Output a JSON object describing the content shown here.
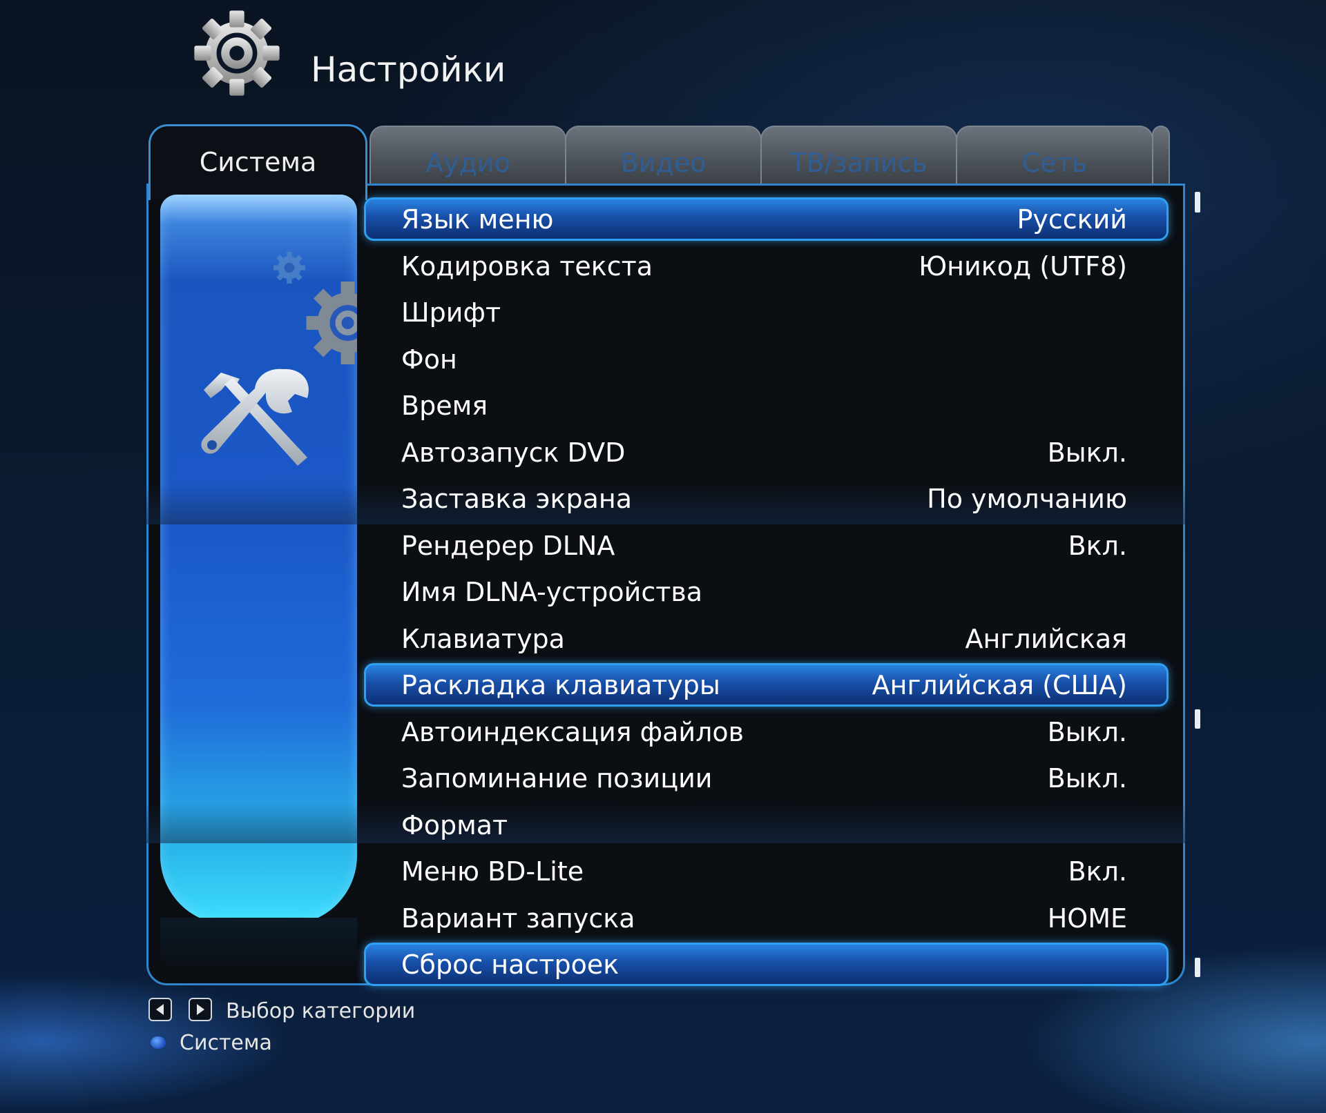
{
  "header": {
    "title": "Настройки",
    "icon": "gear-icon"
  },
  "tabs": [
    {
      "label": "Система",
      "active": true
    },
    {
      "label": "Аудио",
      "active": false
    },
    {
      "label": "Видео",
      "active": false
    },
    {
      "label": "ТВ/запись",
      "active": false
    },
    {
      "label": "Сеть",
      "active": false
    }
  ],
  "sidebar": {
    "icon": "tools-icon",
    "decor_icons": [
      "small-gear-icon",
      "gear-icon"
    ]
  },
  "settings": [
    {
      "label": "Язык меню",
      "value": "Русский",
      "highlighted": true
    },
    {
      "label": "Кодировка текста",
      "value": "Юникод (UTF8)",
      "highlighted": false
    },
    {
      "label": "Шрифт",
      "value": "",
      "highlighted": false
    },
    {
      "label": "Фон",
      "value": "",
      "highlighted": false
    },
    {
      "label": "Время",
      "value": "",
      "highlighted": false
    },
    {
      "label": "Автозапуск DVD",
      "value": "Выкл.",
      "highlighted": false
    },
    {
      "label": "Заставка экрана",
      "value": "По умолчанию",
      "highlighted": false
    },
    {
      "label": "Рендерер DLNA",
      "value": "Вкл.",
      "highlighted": false
    },
    {
      "label": "Имя DLNA-устройства",
      "value": "",
      "highlighted": false
    },
    {
      "label": "Клавиатура",
      "value": "Английская",
      "highlighted": false
    },
    {
      "label": "Раскладка клавиатуры",
      "value": "Английская (США)",
      "highlighted": true
    },
    {
      "label": "Автоиндексация файлов",
      "value": "Выкл.",
      "highlighted": false
    },
    {
      "label": "Запоминание позиции",
      "value": "Выкл.",
      "highlighted": false
    },
    {
      "label": "Формат",
      "value": "",
      "highlighted": false
    },
    {
      "label": "Меню BD-Lite",
      "value": "Вкл.",
      "highlighted": false
    },
    {
      "label": "Вариант запуска",
      "value": "HOME",
      "highlighted": false
    },
    {
      "label": "Сброс настроек",
      "value": "",
      "highlighted": true
    }
  ],
  "footer": {
    "hint": "Выбор категории",
    "hint_icons": [
      "left-arrow-key-icon",
      "right-arrow-key-icon"
    ],
    "status": "Система",
    "status_color": "#2a5fd6"
  },
  "colors": {
    "accent": "#2da0f0",
    "panel_border": "#2f86cf",
    "inactive_tab_text": "#2f5d94"
  }
}
